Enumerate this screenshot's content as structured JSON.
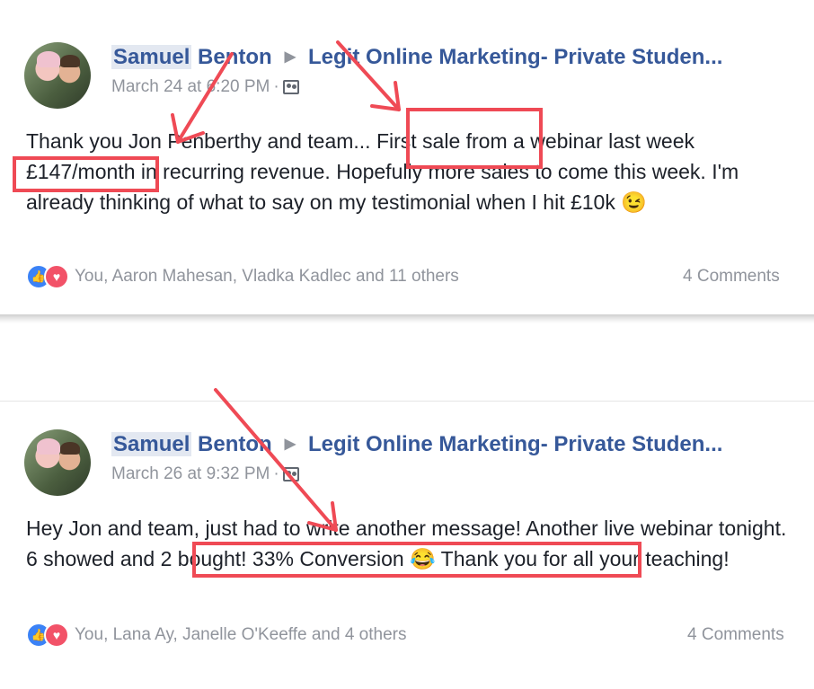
{
  "posts": [
    {
      "author_first": "Samuel",
      "author_last": "Benton",
      "group": "Legit Online Marketing- Private Studen...",
      "date": "March 24 at 6:20 PM",
      "sep": "·",
      "text": "Thank you Jon Penberthy and team... First sale from a webinar last week £147/month in recurring revenue. Hopefully more sales to come this week. I'm already thinking of what to say on my testimonial when I hit £10k 😉",
      "reactions": "You, Aaron Mahesan, Vladka Kadlec and 11 others",
      "comments": "4 Comments"
    },
    {
      "author_first": "Samuel",
      "author_last": "Benton",
      "group": "Legit Online Marketing- Private Studen...",
      "date": "March 26 at 9:32 PM",
      "sep": "·",
      "text": "Hey Jon and team, just had to write another message! Another live webinar tonight. 6 showed and 2 bought! 33% Conversion 😂 Thank you for all your teaching!",
      "reactions": "You, Lana Ay, Janelle O'Keeffe and 4 others",
      "comments": "4 Comments"
    }
  ],
  "icons": {
    "like": "thumbs-up-icon",
    "love": "heart-icon",
    "group": "group-icon",
    "triangle": "right-triangle-icon"
  },
  "colors": {
    "link": "#365899",
    "muted": "#90949c",
    "annotation": "#ef4a55"
  }
}
